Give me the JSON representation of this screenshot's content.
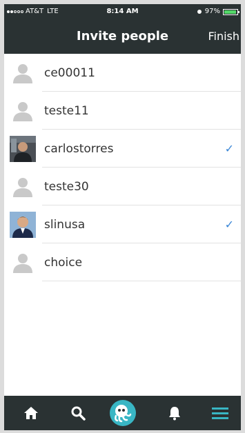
{
  "status_bar": {
    "carrier": "AT&T",
    "network": "LTE",
    "time": "8:14 AM",
    "battery": "97%",
    "battery_level": 0.97
  },
  "nav": {
    "title": "Invite people",
    "finish_label": "Finish"
  },
  "people": [
    {
      "name": "ce00011",
      "avatar": "placeholder",
      "selected": false
    },
    {
      "name": "teste11",
      "avatar": "placeholder",
      "selected": false
    },
    {
      "name": "carlostorres",
      "avatar": "photo",
      "selected": true
    },
    {
      "name": "teste30",
      "avatar": "placeholder",
      "selected": false
    },
    {
      "name": "slinusa",
      "avatar": "photo",
      "selected": true
    },
    {
      "name": "choice",
      "avatar": "placeholder",
      "selected": false
    }
  ],
  "check_mark": "✓",
  "tabs": [
    {
      "icon": "home-icon"
    },
    {
      "icon": "search-icon"
    },
    {
      "icon": "octopus-logo-icon"
    },
    {
      "icon": "bell-icon"
    },
    {
      "icon": "menu-icon"
    }
  ],
  "colors": {
    "bar_bg": "#2a3233",
    "check": "#3a86d6",
    "teal_accent": "#39b6c4"
  }
}
